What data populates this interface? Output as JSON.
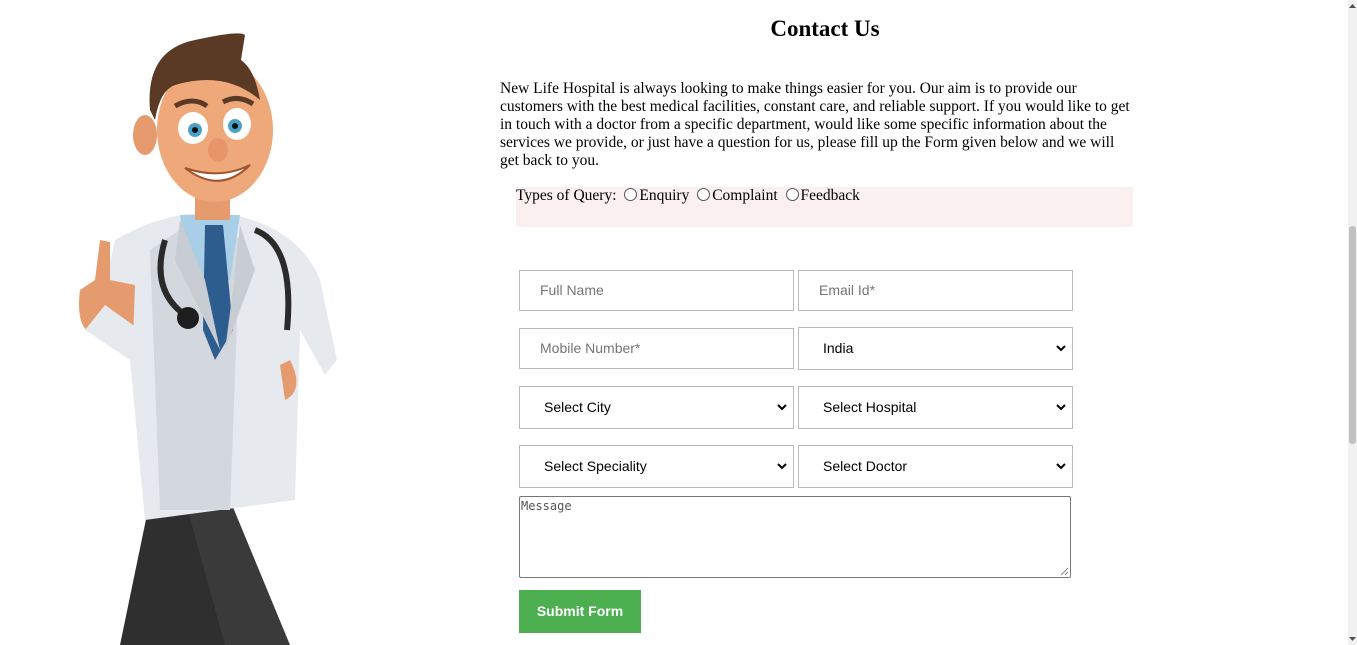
{
  "page": {
    "title": "Contact Us",
    "intro": "New Life Hospital is always looking to make things easier for you. Our aim is to provide our customers with the best medical facilities, constant care, and reliable support. If you would like to get in touch with a doctor from a specific department, would like some specific information about the services we provide, or just have a question for us, please fill up the Form given below and we will get back to you."
  },
  "query": {
    "label": "Types of Query:",
    "options": [
      "Enquiry",
      "Complaint",
      "Feedback"
    ]
  },
  "form": {
    "full_name_placeholder": "Full Name",
    "email_placeholder": "Email Id*",
    "mobile_placeholder": "Mobile Number*",
    "country_selected": "India",
    "city_selected": "Select City",
    "hospital_selected": "Select Hospital",
    "speciality_selected": "Select Speciality",
    "doctor_selected": "Select Doctor",
    "message_placeholder": "Message",
    "submit_label": "Submit Form"
  },
  "colors": {
    "submit_bg": "#4caf50",
    "query_bg": "#faf0ef"
  },
  "icons": {
    "illustration": "doctor-illustration",
    "select_caret": "chevron-down-icon"
  }
}
